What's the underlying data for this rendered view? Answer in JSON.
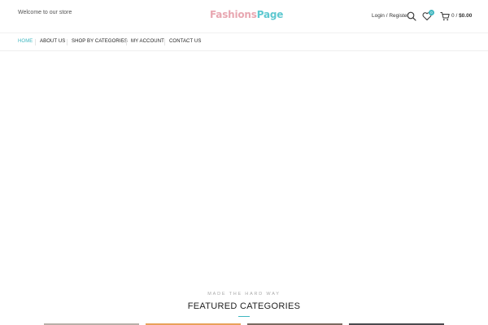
{
  "header": {
    "welcome": "Welcome to our store",
    "logo": {
      "part1": "Fashions",
      "part2": "Page"
    },
    "login": "Login / Register",
    "wishlist_count": "0",
    "cart": {
      "count": "0",
      "separator": "/",
      "total": "$0.00"
    }
  },
  "nav": {
    "items": [
      {
        "label": "HOME",
        "active": true
      },
      {
        "label": "ABOUT US"
      },
      {
        "label": "SHOP BY CATEGORIES"
      },
      {
        "label": "MY ACCOUNT"
      },
      {
        "label": "CONTACT US"
      }
    ]
  },
  "featured": {
    "tagline": "MADE THE HARD WAY",
    "title": "FEATURED CATEGORIES"
  },
  "colors": {
    "accent": "#3fb7c0",
    "logo_pink": "#e8a7b1",
    "logo_teal": "#5ec8d0"
  },
  "icons": [
    "search-icon",
    "heart-icon",
    "cart-icon",
    "chevron-down-icon"
  ]
}
